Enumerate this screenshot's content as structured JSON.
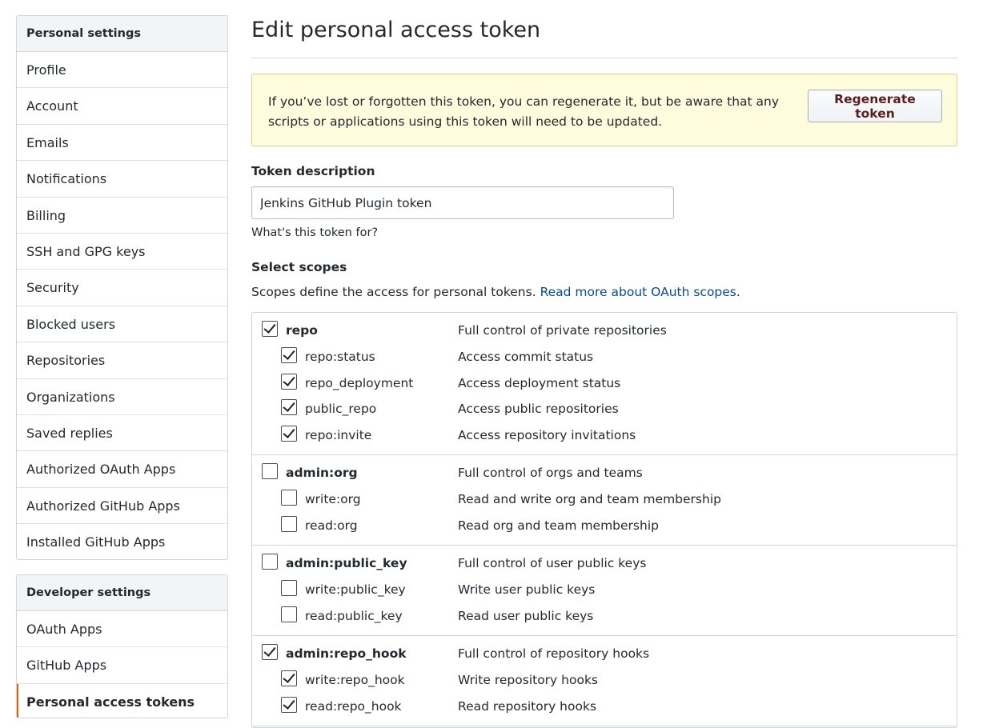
{
  "sidebar": {
    "personal_heading": "Personal settings",
    "personal_items": [
      {
        "label": "Profile"
      },
      {
        "label": "Account"
      },
      {
        "label": "Emails"
      },
      {
        "label": "Notifications"
      },
      {
        "label": "Billing"
      },
      {
        "label": "SSH and GPG keys"
      },
      {
        "label": "Security"
      },
      {
        "label": "Blocked users"
      },
      {
        "label": "Repositories"
      },
      {
        "label": "Organizations"
      },
      {
        "label": "Saved replies"
      },
      {
        "label": "Authorized OAuth Apps"
      },
      {
        "label": "Authorized GitHub Apps"
      },
      {
        "label": "Installed GitHub Apps"
      }
    ],
    "developer_heading": "Developer settings",
    "developer_items": [
      {
        "label": "OAuth Apps"
      },
      {
        "label": "GitHub Apps"
      },
      {
        "label": "Personal access tokens",
        "selected": true
      }
    ]
  },
  "main": {
    "title": "Edit personal access token",
    "flash_text": "If you’ve lost or forgotten this token, you can regenerate it, but be aware that any scripts or applications using this token will need to be updated.",
    "regenerate_label": "Regenerate token",
    "token_description_label": "Token description",
    "token_description_value": "Jenkins GitHub Plugin token",
    "token_note": "What's this token for?",
    "select_scopes_label": "Select scopes",
    "scopes_description": "Scopes define the access for personal tokens.",
    "scopes_link": "Read more about OAuth scopes",
    "scopes_period": "."
  },
  "scopes": [
    {
      "name": "repo",
      "desc": "Full control of private repositories",
      "checked": true,
      "children": [
        {
          "name": "repo:status",
          "desc": "Access commit status",
          "checked": true
        },
        {
          "name": "repo_deployment",
          "desc": "Access deployment status",
          "checked": true
        },
        {
          "name": "public_repo",
          "desc": "Access public repositories",
          "checked": true
        },
        {
          "name": "repo:invite",
          "desc": "Access repository invitations",
          "checked": true
        }
      ]
    },
    {
      "name": "admin:org",
      "desc": "Full control of orgs and teams",
      "checked": false,
      "children": [
        {
          "name": "write:org",
          "desc": "Read and write org and team membership",
          "checked": false
        },
        {
          "name": "read:org",
          "desc": "Read org and team membership",
          "checked": false
        }
      ]
    },
    {
      "name": "admin:public_key",
      "desc": "Full control of user public keys",
      "checked": false,
      "children": [
        {
          "name": "write:public_key",
          "desc": "Write user public keys",
          "checked": false
        },
        {
          "name": "read:public_key",
          "desc": "Read user public keys",
          "checked": false
        }
      ]
    },
    {
      "name": "admin:repo_hook",
      "desc": "Full control of repository hooks",
      "checked": true,
      "children": [
        {
          "name": "write:repo_hook",
          "desc": "Write repository hooks",
          "checked": true
        },
        {
          "name": "read:repo_hook",
          "desc": "Read repository hooks",
          "checked": true
        }
      ]
    }
  ]
}
